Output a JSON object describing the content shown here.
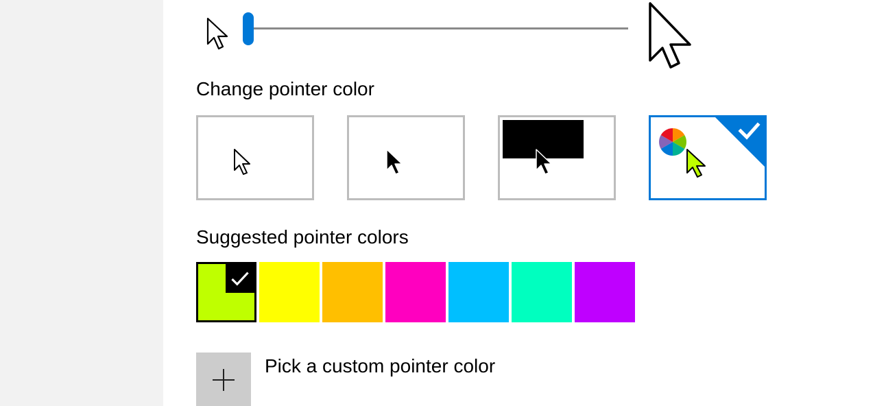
{
  "pointer_size": {
    "level": 0.0
  },
  "pointer_color": {
    "heading": "Change pointer color",
    "options": [
      {
        "name": "white"
      },
      {
        "name": "black"
      },
      {
        "name": "inverted"
      },
      {
        "name": "custom"
      }
    ],
    "selected": "custom",
    "accent": "#0078d7"
  },
  "suggested": {
    "heading": "Suggested pointer colors",
    "colors": [
      "#bfff00",
      "#ffff00",
      "#ffbf00",
      "#ff00bf",
      "#00bfff",
      "#00ffbf",
      "#bf00ff"
    ],
    "selected_index": 0
  },
  "custom": {
    "label": "Pick a custom pointer color",
    "icon": "plus-icon"
  }
}
